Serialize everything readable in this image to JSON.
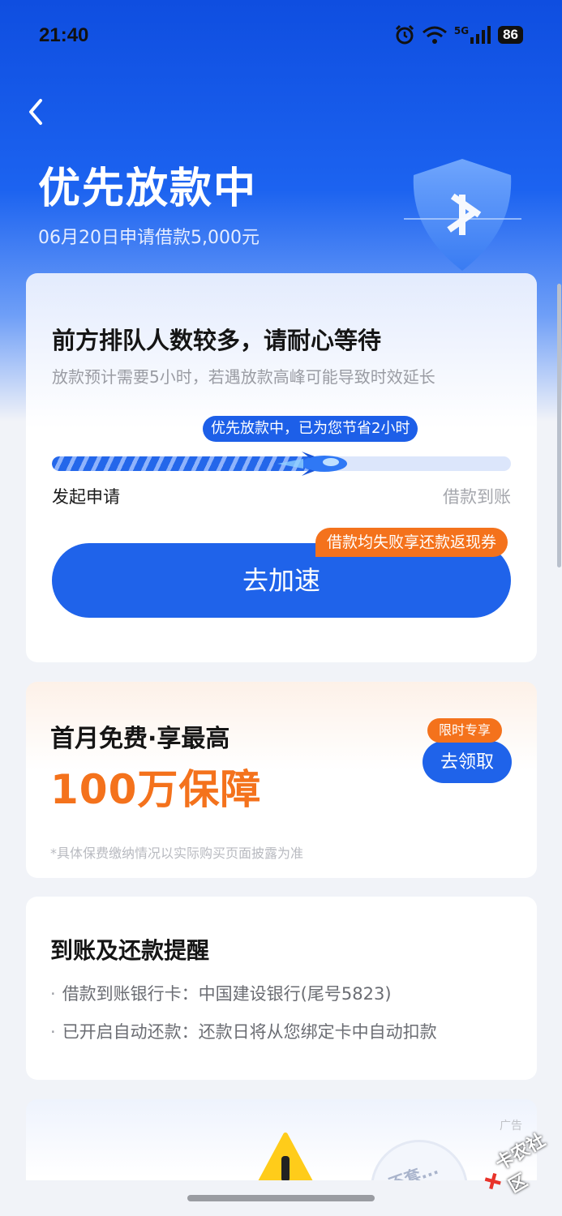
{
  "status_bar": {
    "time": "21:40",
    "battery": "86",
    "network": "5G",
    "icons": [
      "alarm-icon",
      "wifi-icon",
      "signal-icon",
      "battery-icon"
    ]
  },
  "header": {
    "title": "优先放款中",
    "subtitle": "06月20日申请借款5,000元"
  },
  "progress_card": {
    "title": "前方排队人数较多，请耐心等待",
    "description": "放款预计需要5小时，若遇放款高峰可能导致时效延长",
    "tip": "优先放款中，已为您节省2小时",
    "progress_fraction": 0.6,
    "step_start": "发起申请",
    "step_end": "借款到账",
    "button_label": "去加速",
    "button_badge": "借款均失败享还款返现券"
  },
  "insurance_card": {
    "title": "首月免费·享最高",
    "amount": "100万保障",
    "note": "*具体保费缴纳情况以实际购买页面披露为准",
    "tag": "限时专享",
    "button_label": "去领取"
  },
  "reminder_card": {
    "title": "到账及还款提醒",
    "items": [
      "借款到账银行卡：中国建设银行(尾号5823)",
      "已开启自动还款：还款日将从您绑定卡中自动扣款"
    ]
  },
  "ad_card": {
    "label": "广告",
    "circle_text": "不套..."
  },
  "watermark": {
    "text": "卡农社区"
  },
  "colors": {
    "primary": "#1f63ea",
    "accent_orange": "#f4721c",
    "hero_top": "#0f4ee0"
  }
}
